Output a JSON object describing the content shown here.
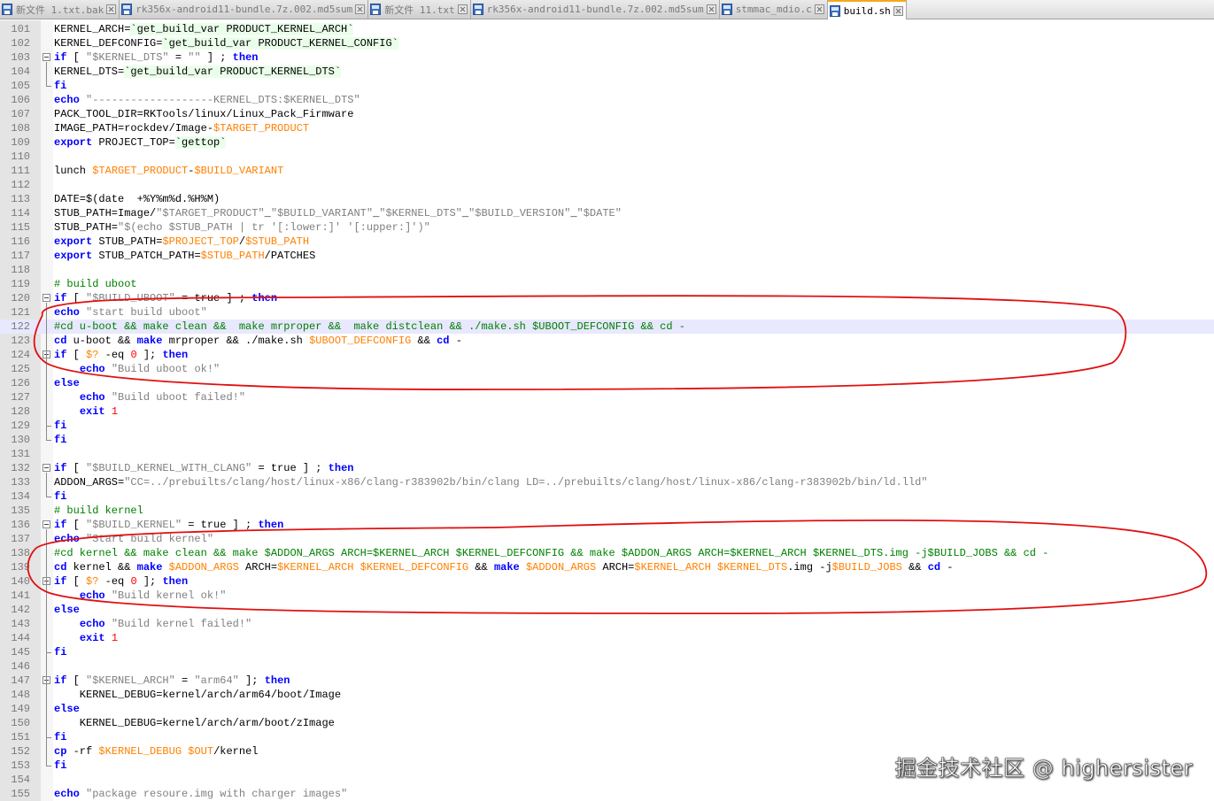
{
  "tabs": [
    {
      "label": "新文件 1.txt.bak",
      "active": false,
      "icon": "file-icon"
    },
    {
      "label": "rk356x-android11-bundle.7z.002.md5sum",
      "active": false,
      "icon": "file-icon"
    },
    {
      "label": "新文件 11.txt",
      "active": false,
      "icon": "file-icon"
    },
    {
      "label": "rk356x-android11-bundle.7z.002.md5sum",
      "active": false,
      "icon": "file-icon"
    },
    {
      "label": "stmmac_mdio.c",
      "active": false,
      "icon": "file-icon"
    },
    {
      "label": "build.sh",
      "active": true,
      "icon": "file-icon"
    }
  ],
  "current_line": 122,
  "lines": [
    {
      "n": "101",
      "code": "KERNEL_ARCH=`get_build_var PRODUCT_KERNEL_ARCH`"
    },
    {
      "n": "102",
      "code": "KERNEL_DEFCONFIG=`get_build_var PRODUCT_KERNEL_CONFIG`"
    },
    {
      "n": "103",
      "code": "if [ \"$KERNEL_DTS\" = \"\" ] ; then"
    },
    {
      "n": "104",
      "code": "KERNEL_DTS=`get_build_var PRODUCT_KERNEL_DTS`"
    },
    {
      "n": "105",
      "code": "fi"
    },
    {
      "n": "106",
      "code": "echo \"-------------------KERNEL_DTS:$KERNEL_DTS\""
    },
    {
      "n": "107",
      "code": "PACK_TOOL_DIR=RKTools/linux/Linux_Pack_Firmware"
    },
    {
      "n": "108",
      "code": "IMAGE_PATH=rockdev/Image-$TARGET_PRODUCT"
    },
    {
      "n": "109",
      "code": "export PROJECT_TOP=`gettop`"
    },
    {
      "n": "110",
      "code": ""
    },
    {
      "n": "111",
      "code": "lunch $TARGET_PRODUCT-$BUILD_VARIANT"
    },
    {
      "n": "112",
      "code": ""
    },
    {
      "n": "113",
      "code": "DATE=$(date  +%Y%m%d.%H%M)"
    },
    {
      "n": "114",
      "code": "STUB_PATH=Image/\"$TARGET_PRODUCT\"_\"$BUILD_VARIANT\"_\"$KERNEL_DTS\"_\"$BUILD_VERSION\"_\"$DATE\""
    },
    {
      "n": "115",
      "code": "STUB_PATH=\"$(echo $STUB_PATH | tr '[:lower:]' '[:upper:]')\""
    },
    {
      "n": "116",
      "code": "export STUB_PATH=$PROJECT_TOP/$STUB_PATH"
    },
    {
      "n": "117",
      "code": "export STUB_PATCH_PATH=$STUB_PATH/PATCHES"
    },
    {
      "n": "118",
      "code": ""
    },
    {
      "n": "119",
      "code": "# build uboot"
    },
    {
      "n": "120",
      "code": "if [ \"$BUILD_UBOOT\" = true ] ; then"
    },
    {
      "n": "121",
      "code": "echo \"start build uboot\""
    },
    {
      "n": "122",
      "code": "#cd u-boot && make clean &&  make mrproper &&  make distclean && ./make.sh $UBOOT_DEFCONFIG && cd -"
    },
    {
      "n": "123",
      "code": "cd u-boot && make mrproper && ./make.sh $UBOOT_DEFCONFIG && cd -"
    },
    {
      "n": "124",
      "code": "if [ $? -eq 0 ]; then"
    },
    {
      "n": "125",
      "code": "    echo \"Build uboot ok!\""
    },
    {
      "n": "126",
      "code": "else"
    },
    {
      "n": "127",
      "code": "    echo \"Build uboot failed!\""
    },
    {
      "n": "128",
      "code": "    exit 1"
    },
    {
      "n": "129",
      "code": "fi"
    },
    {
      "n": "130",
      "code": "fi"
    },
    {
      "n": "131",
      "code": ""
    },
    {
      "n": "132",
      "code": "if [ \"$BUILD_KERNEL_WITH_CLANG\" = true ] ; then"
    },
    {
      "n": "133",
      "code": "ADDON_ARGS=\"CC=../prebuilts/clang/host/linux-x86/clang-r383902b/bin/clang LD=../prebuilts/clang/host/linux-x86/clang-r383902b/bin/ld.lld\""
    },
    {
      "n": "134",
      "code": "fi"
    },
    {
      "n": "135",
      "code": "# build kernel"
    },
    {
      "n": "136",
      "code": "if [ \"$BUILD_KERNEL\" = true ] ; then"
    },
    {
      "n": "137",
      "code": "echo \"Start build kernel\""
    },
    {
      "n": "138",
      "code": "#cd kernel && make clean && make $ADDON_ARGS ARCH=$KERNEL_ARCH $KERNEL_DEFCONFIG && make $ADDON_ARGS ARCH=$KERNEL_ARCH $KERNEL_DTS.img -j$BUILD_JOBS && cd -"
    },
    {
      "n": "139",
      "code": "cd kernel && make $ADDON_ARGS ARCH=$KERNEL_ARCH $KERNEL_DEFCONFIG && make $ADDON_ARGS ARCH=$KERNEL_ARCH $KERNEL_DTS.img -j$BUILD_JOBS && cd -"
    },
    {
      "n": "140",
      "code": "if [ $? -eq 0 ]; then"
    },
    {
      "n": "141",
      "code": "    echo \"Build kernel ok!\""
    },
    {
      "n": "142",
      "code": "else"
    },
    {
      "n": "143",
      "code": "    echo \"Build kernel failed!\""
    },
    {
      "n": "144",
      "code": "    exit 1"
    },
    {
      "n": "145",
      "code": "fi"
    },
    {
      "n": "146",
      "code": ""
    },
    {
      "n": "147",
      "code": "if [ \"$KERNEL_ARCH\" = \"arm64\" ]; then"
    },
    {
      "n": "148",
      "code": "    KERNEL_DEBUG=kernel/arch/arm64/boot/Image"
    },
    {
      "n": "149",
      "code": "else"
    },
    {
      "n": "150",
      "code": "    KERNEL_DEBUG=kernel/arch/arm/boot/zImage"
    },
    {
      "n": "151",
      "code": "fi"
    },
    {
      "n": "152",
      "code": "cp -rf $KERNEL_DEBUG $OUT/kernel"
    },
    {
      "n": "153",
      "code": "fi"
    },
    {
      "n": "154",
      "code": ""
    },
    {
      "n": "155",
      "code": "echo \"package resoure.img with charger images\""
    }
  ],
  "fold_markers": [
    "103",
    "120",
    "124",
    "132",
    "136",
    "140",
    "147"
  ],
  "watermark": "掘金技术社区 @ highersister",
  "colors": {
    "keyword": "#0000ff",
    "string": "#808080",
    "variable": "#ff8000",
    "comment": "#008000",
    "number": "#ff0000",
    "annotation": "#e01010"
  }
}
